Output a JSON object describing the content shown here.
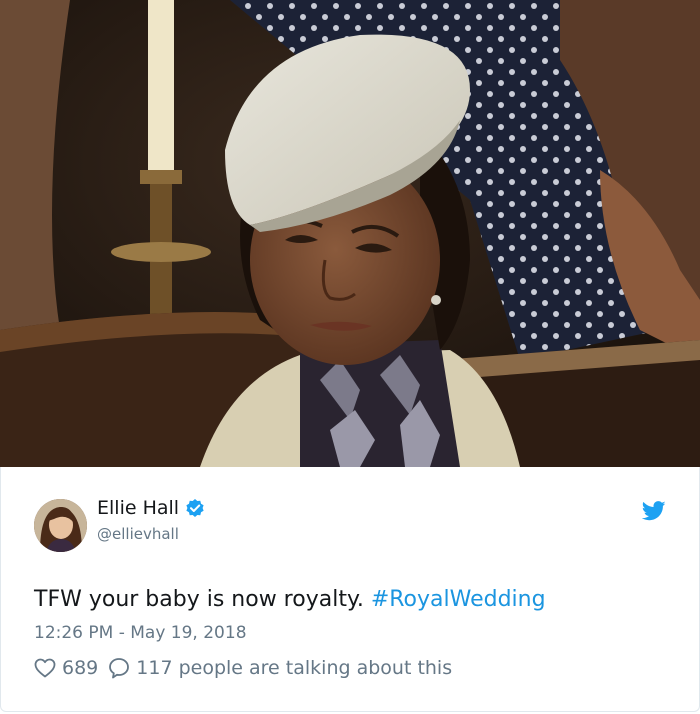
{
  "tweet": {
    "author": {
      "display_name": "Ellie Hall",
      "handle": "@ellievhall",
      "verified": true
    },
    "text_main": "TFW your baby is now royalty. ",
    "hashtag": "#RoyalWedding",
    "timestamp": "12:26 PM - May 19, 2018",
    "likes": "689",
    "talking_count": "117",
    "talking_text": "people are talking about this"
  },
  "colors": {
    "link": "#1b95e0",
    "muted": "#657786",
    "text": "#14171a",
    "twitter_blue": "#1da1f2"
  },
  "icons": {
    "verified": "verified-badge-icon",
    "bird": "twitter-bird-icon",
    "like": "heart-icon",
    "reply": "speech-bubble-icon"
  }
}
